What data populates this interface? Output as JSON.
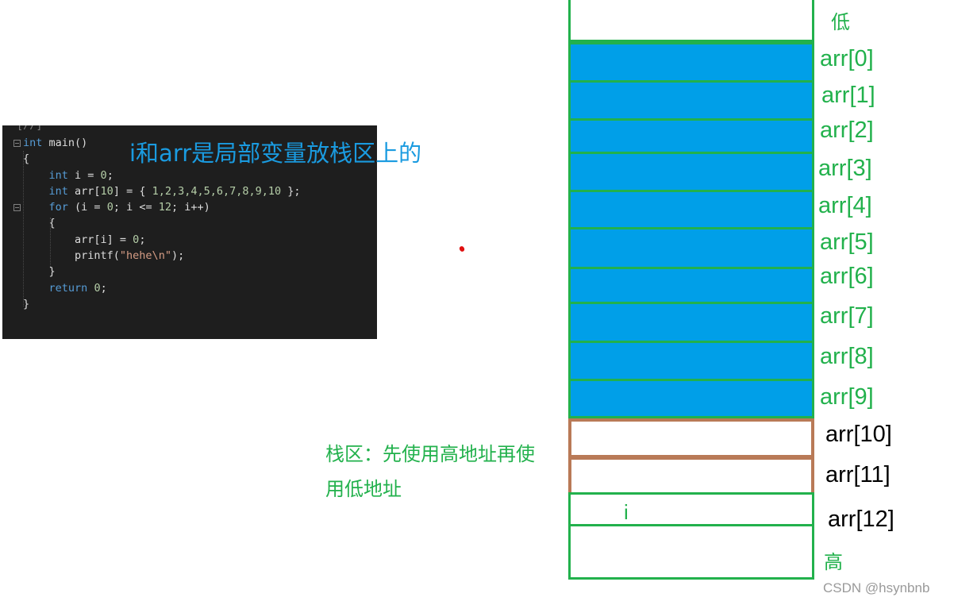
{
  "code": {
    "top_fragment": "[//]",
    "lines": [
      {
        "parts": [
          {
            "t": "int",
            "c": "kw"
          },
          {
            "t": " main()",
            "c": "fn"
          }
        ]
      },
      {
        "parts": [
          {
            "t": "{",
            "c": "fn"
          }
        ]
      },
      {
        "parts": [
          {
            "t": "    ",
            "c": "fn"
          },
          {
            "t": "int",
            "c": "kw"
          },
          {
            "t": " i = ",
            "c": "fn"
          },
          {
            "t": "0",
            "c": "num"
          },
          {
            "t": ";",
            "c": "fn"
          }
        ]
      },
      {
        "parts": [
          {
            "t": "    ",
            "c": "fn"
          },
          {
            "t": "int",
            "c": "kw"
          },
          {
            "t": " arr[",
            "c": "fn"
          },
          {
            "t": "10",
            "c": "num"
          },
          {
            "t": "] = { ",
            "c": "fn"
          },
          {
            "t": "1,2,3,4,5,6,7,8,9,10",
            "c": "num"
          },
          {
            "t": " };",
            "c": "fn"
          }
        ]
      },
      {
        "parts": [
          {
            "t": "    ",
            "c": "fn"
          },
          {
            "t": "for",
            "c": "kw"
          },
          {
            "t": " (i = ",
            "c": "fn"
          },
          {
            "t": "0",
            "c": "num"
          },
          {
            "t": "; i <= ",
            "c": "fn"
          },
          {
            "t": "12",
            "c": "num"
          },
          {
            "t": "; i++)",
            "c": "fn"
          }
        ]
      },
      {
        "parts": [
          {
            "t": "    {",
            "c": "fn"
          }
        ]
      },
      {
        "parts": [
          {
            "t": "        arr[i] = ",
            "c": "fn"
          },
          {
            "t": "0",
            "c": "num"
          },
          {
            "t": ";",
            "c": "fn"
          }
        ]
      },
      {
        "parts": [
          {
            "t": "        printf(",
            "c": "fn"
          },
          {
            "t": "\"hehe\\n\"",
            "c": "str"
          },
          {
            "t": ");",
            "c": "fn"
          }
        ]
      },
      {
        "parts": [
          {
            "t": "    }",
            "c": "fn"
          }
        ]
      },
      {
        "parts": [
          {
            "t": "    ",
            "c": "fn"
          },
          {
            "t": "return",
            "c": "kw"
          },
          {
            "t": " ",
            "c": "fn"
          },
          {
            "t": "0",
            "c": "num"
          },
          {
            "t": ";",
            "c": "fn"
          }
        ]
      },
      {
        "parts": [
          {
            "t": "}",
            "c": "fn"
          }
        ]
      }
    ]
  },
  "caption": "i和arr是局部变量放栈区上的",
  "stack": {
    "low_label": "低",
    "high_label": "高",
    "arr_labels": [
      "arr[0]",
      "arr[1]",
      "arr[2]",
      "arr[3]",
      "arr[4]",
      "arr[5]",
      "arr[6]",
      "arr[7]",
      "arr[8]",
      "arr[9]",
      "arr[10]",
      "arr[11]",
      "arr[12]"
    ],
    "i_label": "i"
  },
  "note": {
    "line1": "栈区：先使用高地址再使",
    "line2": "用低地址"
  },
  "watermark": "CSDN @hsynbnb",
  "colors": {
    "cell_fill": "#009fe8",
    "cell_border": "#22b14c",
    "out_of_bounds_border": "#b97a57",
    "caption": "#1a9be0",
    "label_green": "#22b14c",
    "code_bg": "#1e1e1e"
  }
}
